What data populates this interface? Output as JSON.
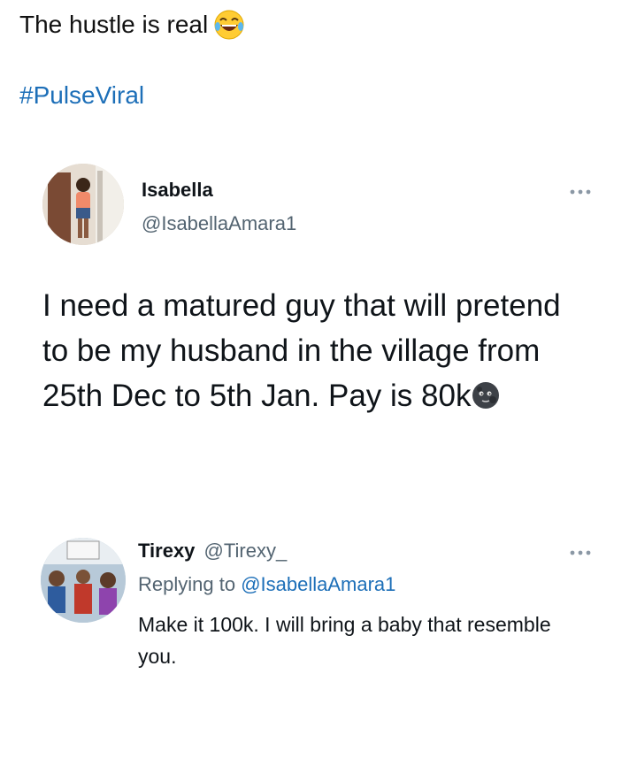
{
  "caption": {
    "text": "The hustle is real",
    "emoji_icon": "face-with-tears-of-joy-icon"
  },
  "hashtag": "#PulseViral",
  "main_tweet": {
    "author_name": "Isabella",
    "author_handle": "@IsabellaAmara1",
    "text": "I need a matured guy that will pretend to be my husband in the village from 25th Dec to 5th Jan. Pay is 80k",
    "trailing_emoji_icon": "new-moon-face-icon",
    "more_icon": "more-options-icon"
  },
  "reply_tweet": {
    "author_name": "Tirexy",
    "author_handle": "@Tirexy_",
    "replying_to_label": "Replying to",
    "replying_to_handle": "@IsabellaAmara1",
    "text": "Make it 100k. I will bring a baby that resemble you.",
    "more_icon": "more-options-icon"
  },
  "colors": {
    "link": "#1d6fb8",
    "secondary_text": "#536471",
    "primary_text": "#0f1419"
  }
}
